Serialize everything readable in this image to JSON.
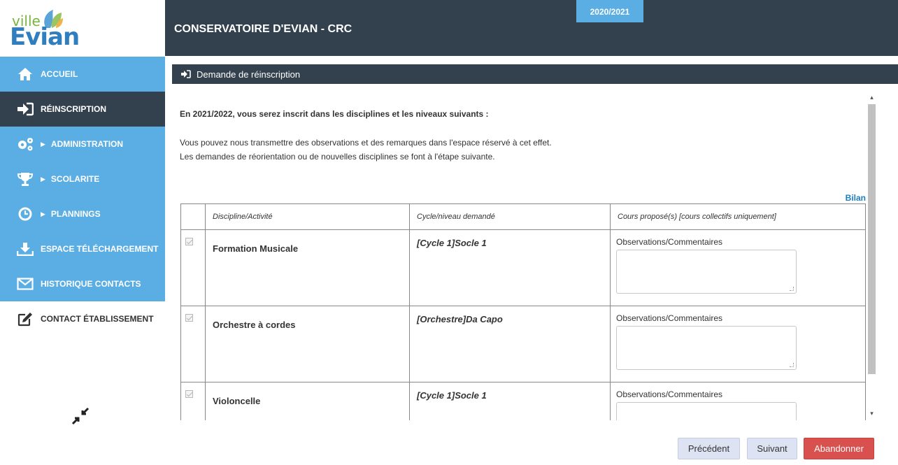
{
  "logo": {
    "ville": "ville",
    "evian": "Evian"
  },
  "header": {
    "title": "CONSERVATOIRE D'EVIAN - CRC",
    "year": "2020/2021"
  },
  "sidebar": {
    "items": [
      {
        "label": "ACCUEIL",
        "icon": "home-icon",
        "caret": false
      },
      {
        "label": "RÉINSCRIPTION",
        "icon": "sign-in-icon",
        "caret": false
      },
      {
        "label": "ADMINISTRATION",
        "icon": "gears-icon",
        "caret": true
      },
      {
        "label": "SCOLARITE",
        "icon": "trophy-icon",
        "caret": true
      },
      {
        "label": "PLANNINGS",
        "icon": "clock-icon",
        "caret": true
      },
      {
        "label": "ESPACE TÉLÉCHARGEMENT",
        "icon": "download-icon",
        "caret": false
      },
      {
        "label": "HISTORIQUE CONTACTS",
        "icon": "envelope-icon",
        "caret": false
      },
      {
        "label": "CONTACT ÉTABLISSEMENT",
        "icon": "edit-icon",
        "caret": false
      }
    ],
    "collapse_icon": "compress-icon"
  },
  "panel": {
    "title": "Demande de réinscription"
  },
  "content": {
    "intro": "En 2021/2022, vous serez inscrit dans les disciplines et les niveaux suivants :",
    "p1": "Vous pouvez nous transmettre des observations et des remarques dans l'espace réservé à cet effet.",
    "p2": "Les demandes de réorientation ou de nouvelles disciplines se font à l'étape suivante.",
    "bilan": "Bilan"
  },
  "table": {
    "headers": [
      "Discipline/Activité",
      "Cycle/niveau demandé",
      "Cours proposé(s) [cours collectifs uniquement]"
    ],
    "rows": [
      {
        "discipline": "Formation Musicale",
        "cycle": "[Cycle 1]Socle 1",
        "obs_label": "Observations/Commentaires",
        "obs_value": ""
      },
      {
        "discipline": "Orchestre à cordes",
        "cycle": "[Orchestre]Da Capo",
        "obs_label": "Observations/Commentaires",
        "obs_value": ""
      },
      {
        "discipline": "Violoncelle",
        "cycle": "[Cycle 1]Socle 1",
        "obs_label": "Observations/Commentaires",
        "obs_value": ""
      }
    ]
  },
  "buttons": {
    "prev": "Précédent",
    "next": "Suivant",
    "abort": "Abandonner"
  },
  "colors": {
    "dark": "#33404d",
    "accent_blue": "#5aaee4",
    "danger": "#d9514e",
    "link": "#1a7ec0"
  }
}
